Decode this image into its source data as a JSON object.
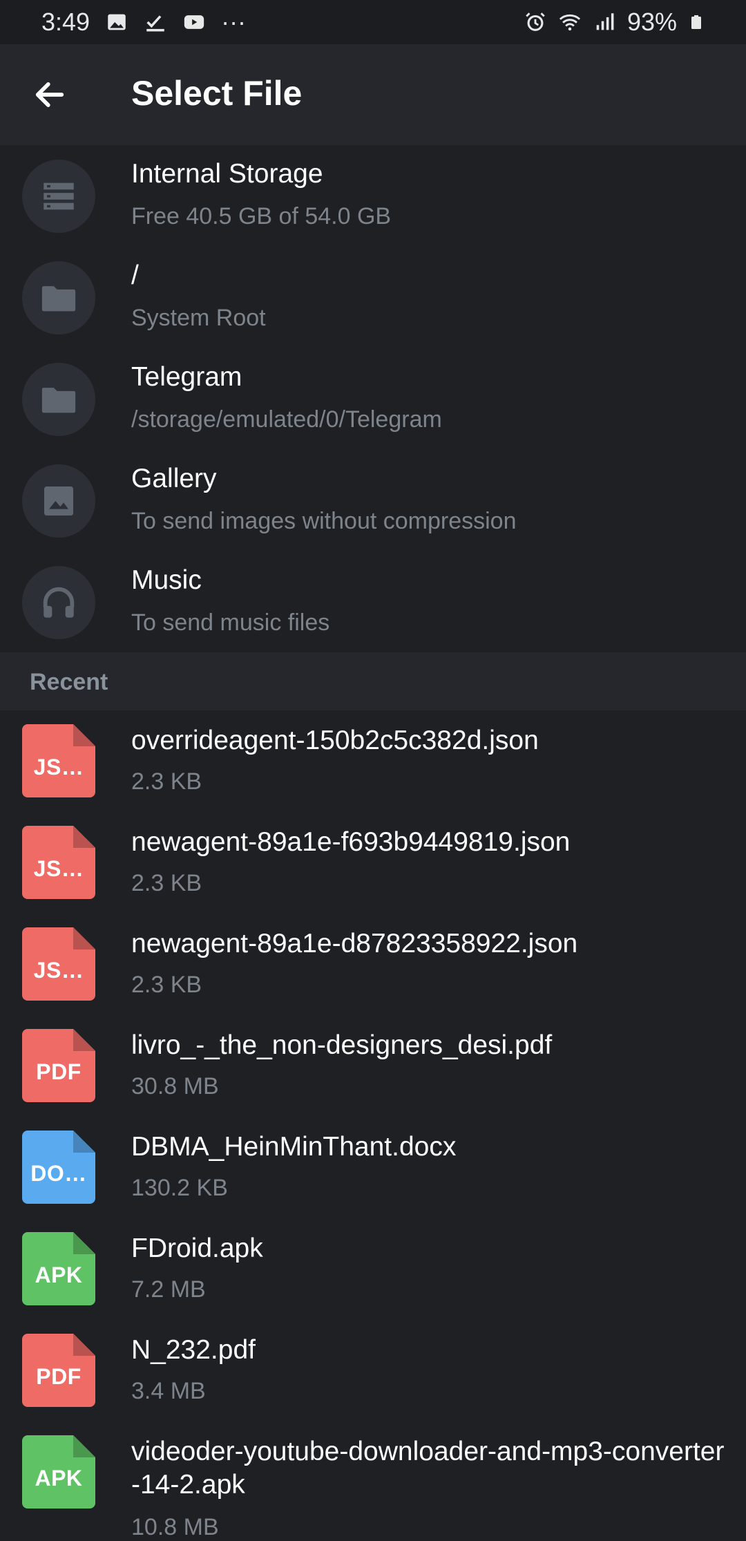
{
  "status_bar": {
    "time": "3:49",
    "more": "···",
    "battery": "93%"
  },
  "app_bar": {
    "title": "Select File",
    "back_icon": "arrow-left-icon"
  },
  "storage": [
    {
      "title": "Internal Storage",
      "subtitle": "Free 40.5 GB of 54.0 GB",
      "icon": "storage-icon"
    },
    {
      "title": "/",
      "subtitle": "System Root",
      "icon": "folder-icon"
    },
    {
      "title": "Telegram",
      "subtitle": "/storage/emulated/0/Telegram",
      "icon": "folder-icon"
    },
    {
      "title": "Gallery",
      "subtitle": "To send images without compression",
      "icon": "image-icon"
    },
    {
      "title": "Music",
      "subtitle": "To send music files",
      "icon": "headphones-icon"
    }
  ],
  "recent_header": "Recent",
  "colors": {
    "red": "#ef6b66",
    "blue": "#5aaaf0",
    "green": "#5fc264"
  },
  "recent_files": [
    {
      "name": "overrideagent-150b2c5c382d.json",
      "size": "2.3 KB",
      "ext": "JS…",
      "color": "red"
    },
    {
      "name": "newagent-89a1e-f693b9449819.json",
      "size": "2.3 KB",
      "ext": "JS…",
      "color": "red"
    },
    {
      "name": "newagent-89a1e-d87823358922.json",
      "size": "2.3 KB",
      "ext": "JS…",
      "color": "red"
    },
    {
      "name": "livro_-_the_non-designers_desi.pdf",
      "size": "30.8 MB",
      "ext": "PDF",
      "color": "red"
    },
    {
      "name": "DBMA_HeinMinThant.docx",
      "size": "130.2 KB",
      "ext": "DO…",
      "color": "blue"
    },
    {
      "name": "FDroid.apk",
      "size": "7.2 MB",
      "ext": "APK",
      "color": "green"
    },
    {
      "name": "N_232.pdf",
      "size": "3.4 MB",
      "ext": "PDF",
      "color": "red"
    },
    {
      "name": "videoder-youtube-downloader-and-mp3-converter-14-2.apk",
      "size": "10.8 MB",
      "ext": "APK",
      "color": "green"
    }
  ]
}
